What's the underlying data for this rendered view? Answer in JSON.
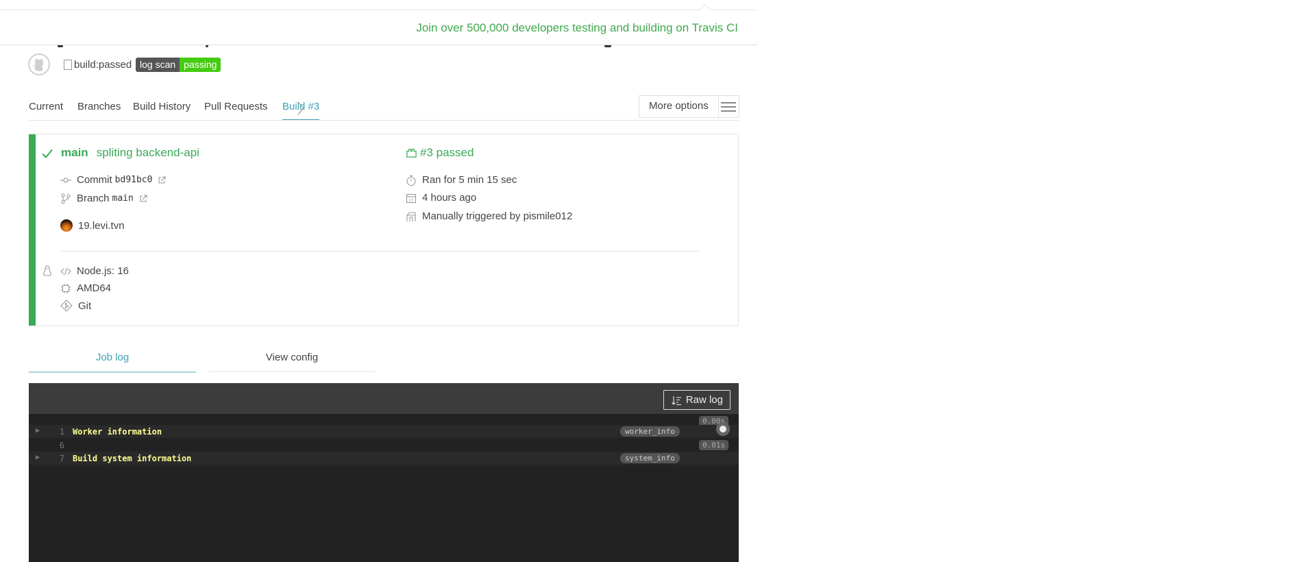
{
  "promo": {
    "text": "Join over 500,000 developers testing and building on Travis CI"
  },
  "repo": {
    "build_image_alt": "build:passed",
    "badge": {
      "label": "log scan",
      "status": "passing"
    }
  },
  "nav": {
    "tabs": [
      {
        "label": "Current"
      },
      {
        "label": "Branches"
      },
      {
        "label": "Build History"
      },
      {
        "label": "Pull Requests"
      },
      {
        "label": "Build #3",
        "active": true
      }
    ],
    "more_options": "More options"
  },
  "build": {
    "branch": "main",
    "message": "spliting backend-api",
    "status": "#3 passed",
    "commit_label": "Commit",
    "commit_sha": "bd91bc0",
    "branch_label": "Branch",
    "branch_name": "main",
    "author": "19.levi.tvn",
    "duration": "Ran for 5 min 15 sec",
    "finished": "4 hours ago",
    "trigger": "Manually triggered by pismile012",
    "language": "Node.js: 16",
    "arch": "AMD64",
    "git": "Git",
    "status_color": "#39aa56"
  },
  "job_tabs": {
    "log": "Job log",
    "config": "View config"
  },
  "log": {
    "raw_label": "Raw log",
    "lines": [
      {
        "num": "1",
        "text": "Worker information",
        "fold": "worker_info",
        "duration": "0.00s"
      },
      {
        "num": "6",
        "text": "",
        "fold": "",
        "duration": "0.01s"
      },
      {
        "num": "7",
        "text": "Build system information",
        "fold": "system_info",
        "duration": ""
      }
    ]
  }
}
